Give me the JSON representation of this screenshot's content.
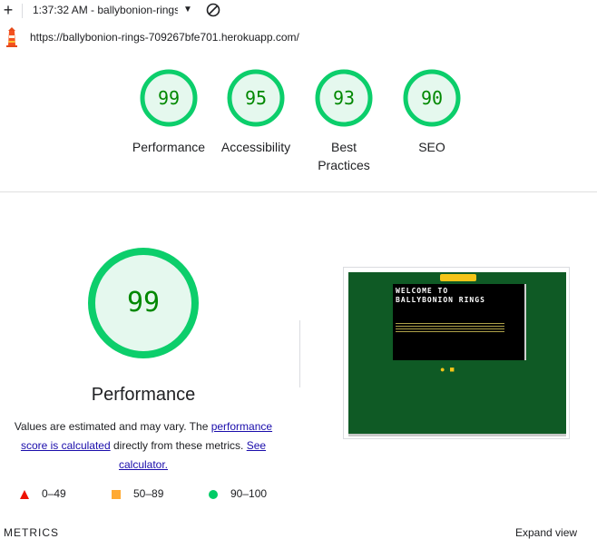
{
  "toolbar": {
    "report_select": "1:37:32 AM - ballybonion-rings",
    "icons": [
      "plus-icon",
      "caret-down-icon",
      "block-icon"
    ]
  },
  "url": "https://ballybonion-rings-709267bfe701.herokuapp.com/",
  "categories": [
    {
      "score": 99,
      "label": "Performance"
    },
    {
      "score": 95,
      "label": "Accessibility"
    },
    {
      "score": 93,
      "label": "Best Practices"
    },
    {
      "score": 90,
      "label": "SEO"
    }
  ],
  "performance": {
    "score": 99,
    "title": "Performance",
    "note_pre": "Values are estimated and may vary. The ",
    "note_link1": "performance score is calculated",
    "note_mid": " directly from these metrics. ",
    "note_link2": "See calculator."
  },
  "screenshot": {
    "heading": "WELCOME TO BALLYBONION RINGS"
  },
  "legend": [
    {
      "marker": "triangle",
      "range": "0–49",
      "color": "#ee1100"
    },
    {
      "marker": "square",
      "range": "50–89",
      "color": "#ffaa33"
    },
    {
      "marker": "circle",
      "range": "90–100",
      "color": "#00cc66"
    }
  ],
  "metrics": {
    "heading": "METRICS",
    "expand": "Expand view"
  },
  "colors": {
    "pass": "#0cce6b",
    "pass_fill": "#e5f8ee",
    "pass_text": "#008800"
  }
}
